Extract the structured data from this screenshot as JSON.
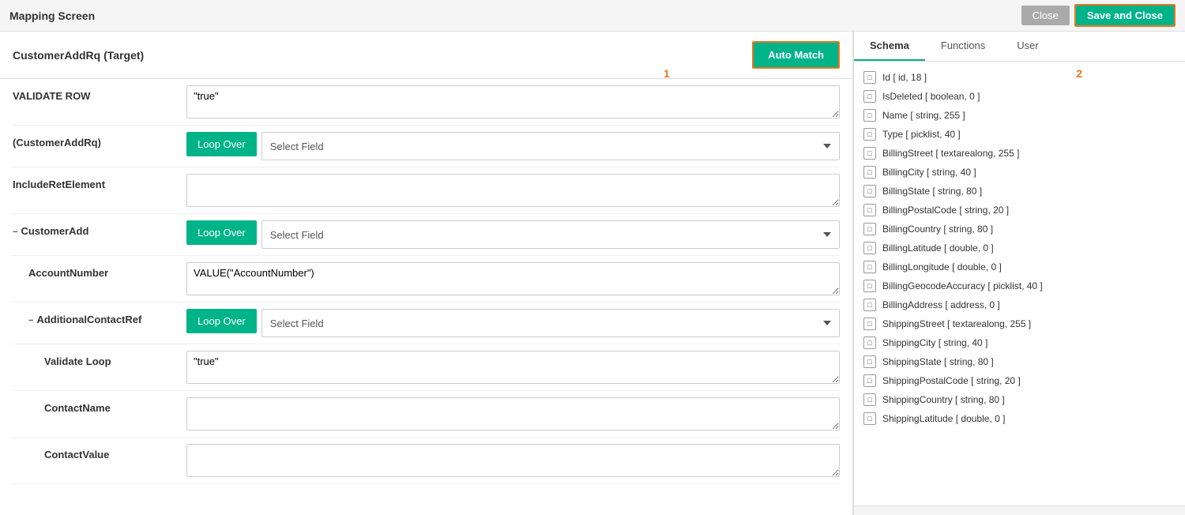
{
  "header": {
    "title": "Mapping Screen",
    "close_label": "Close",
    "save_close_label": "Save and Close"
  },
  "badge1": "1",
  "badge2": "2",
  "left_panel": {
    "target_title": "CustomerAddRq (Target)",
    "auto_match_label": "Auto Match",
    "rows": [
      {
        "id": "validate_row",
        "label": "VALIDATE ROW",
        "indent": 0,
        "type": "textarea",
        "value": "\"true\""
      },
      {
        "id": "customer_add_rq",
        "label": "(CustomerAddRq)",
        "indent": 0,
        "type": "loop_select",
        "select_value": "Select Field"
      },
      {
        "id": "include_ret_element",
        "label": "IncludeRetElement",
        "indent": 0,
        "type": "textarea",
        "value": ""
      },
      {
        "id": "customer_add",
        "label": "CustomerAdd",
        "indent": 0,
        "collapse": true,
        "type": "loop_select",
        "select_value": "Select Field"
      },
      {
        "id": "account_number",
        "label": "AccountNumber",
        "indent": 1,
        "type": "textarea",
        "value": "VALUE(\"AccountNumber\")"
      },
      {
        "id": "additional_contact_ref",
        "label": "AdditionalContactRef",
        "indent": 1,
        "collapse": true,
        "type": "loop_select",
        "select_value": "Select Field"
      },
      {
        "id": "validate_loop",
        "label": "Validate Loop",
        "indent": 2,
        "type": "textarea",
        "value": "\"true\""
      },
      {
        "id": "contact_name",
        "label": "ContactName",
        "indent": 2,
        "type": "textarea",
        "value": ""
      },
      {
        "id": "contact_value",
        "label": "ContactValue",
        "indent": 2,
        "type": "textarea",
        "value": ""
      }
    ]
  },
  "right_panel": {
    "tabs": [
      {
        "id": "schema",
        "label": "Schema",
        "active": true
      },
      {
        "id": "functions",
        "label": "Functions",
        "active": false
      },
      {
        "id": "user",
        "label": "User",
        "active": false
      }
    ],
    "schema_items": [
      {
        "id": "Id",
        "text": "Id [ id, 18 ]"
      },
      {
        "id": "IsDeleted",
        "text": "IsDeleted [ boolean, 0 ]"
      },
      {
        "id": "Name",
        "text": "Name [ string, 255 ]"
      },
      {
        "id": "Type",
        "text": "Type [ picklist, 40 ]"
      },
      {
        "id": "BillingStreet",
        "text": "BillingStreet [ textarealong, 255 ]"
      },
      {
        "id": "BillingCity",
        "text": "BillingCity [ string, 40 ]"
      },
      {
        "id": "BillingState",
        "text": "BillingState [ string, 80 ]"
      },
      {
        "id": "BillingPostalCode",
        "text": "BillingPostalCode [ string, 20 ]"
      },
      {
        "id": "BillingCountry",
        "text": "BillingCountry [ string, 80 ]"
      },
      {
        "id": "BillingLatitude",
        "text": "BillingLatitude [ double, 0 ]"
      },
      {
        "id": "BillingLongitude",
        "text": "BillingLongitude [ double, 0 ]"
      },
      {
        "id": "BillingGeocodeAccuracy",
        "text": "BillingGeocodeAccuracy [ picklist, 40 ]"
      },
      {
        "id": "BillingAddress",
        "text": "BillingAddress [ address, 0 ]"
      },
      {
        "id": "ShippingStreet",
        "text": "ShippingStreet [ textarealong, 255 ]"
      },
      {
        "id": "ShippingCity",
        "text": "ShippingCity [ string, 40 ]"
      },
      {
        "id": "ShippingState",
        "text": "ShippingState [ string, 80 ]"
      },
      {
        "id": "ShippingPostalCode",
        "text": "ShippingPostalCode [ string, 20 ]"
      },
      {
        "id": "ShippingCountry",
        "text": "ShippingCountry [ string, 80 ]"
      },
      {
        "id": "ShippingLatitude",
        "text": "ShippingLatitude [ double, 0 ]"
      }
    ]
  }
}
